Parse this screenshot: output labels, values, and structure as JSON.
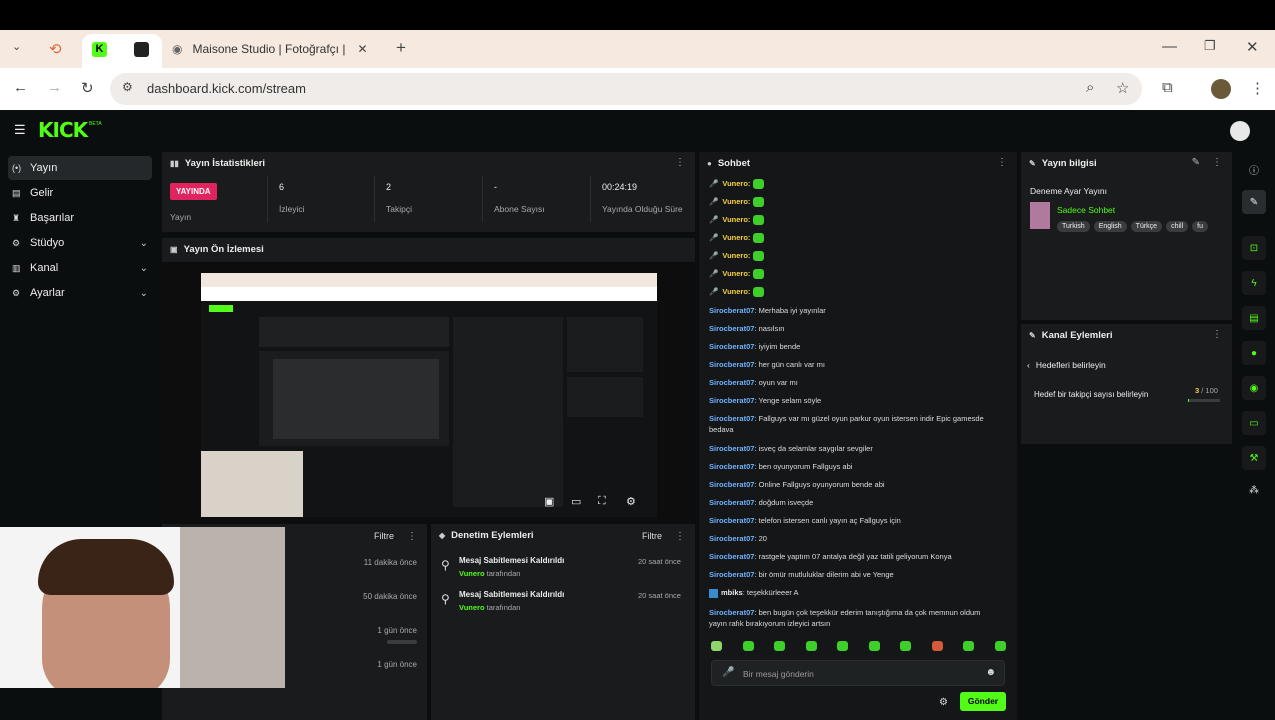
{
  "browser": {
    "tab_title": "Maisone Studio | Fotoğrafçı | İzı",
    "url": "dashboard.kick.com/stream",
    "icons": [
      "chevron-down-icon",
      "history-icon",
      "kick-favicon",
      "puzzle-favicon",
      "close-icon",
      "plus-icon",
      "back-icon",
      "forward-icon",
      "reload-icon",
      "site-info-icon",
      "zoom-icon",
      "star-icon",
      "extension-icon",
      "profile-avatar",
      "menu-icon"
    ]
  },
  "app": {
    "logo": "KICK",
    "logo_suffix": "BETA",
    "accent": "#53fc18"
  },
  "sidebar": {
    "items": [
      {
        "label": "Yayın",
        "icon": "broadcast-icon",
        "active": true
      },
      {
        "label": "Gelir",
        "icon": "wallet-icon"
      },
      {
        "label": "Başarılar",
        "icon": "trophy-icon"
      },
      {
        "label": "Stüdyo",
        "icon": "gear-icon",
        "expandable": true
      },
      {
        "label": "Kanal",
        "icon": "chart-icon",
        "expandable": true
      },
      {
        "label": "Ayarlar",
        "icon": "settings-icon",
        "expandable": true
      }
    ]
  },
  "stats": {
    "title": "Yayın İstatistikleri",
    "live_badge": "YAYINDA",
    "status_label": "Yayın",
    "viewers": "6",
    "viewers_label": "İzleyici",
    "followers": "2",
    "followers_label": "Takipçi",
    "subs": "-",
    "subs_label": "Abone Sayısı",
    "duration": "00:24:19",
    "duration_label": "Yayında Olduğu Süre"
  },
  "preview": {
    "title": "Yayın Ön İzlemesi"
  },
  "activity": {
    "filter": "Filtre",
    "times": [
      "11 dakika önce",
      "50 dakika önce",
      "1 gün önce",
      "1 gün önce"
    ]
  },
  "moderation": {
    "title": "Denetim Eylemleri",
    "filter": "Filtre",
    "rows": [
      {
        "action": "Mesaj Sabitlemesi Kaldırıldı",
        "user": "Vunero",
        "suffix": "tarafından",
        "time": "20 saat önce"
      },
      {
        "action": "Mesaj Sabitlemesi Kaldırıldı",
        "user": "Vunero",
        "suffix": "tarafından",
        "time": "20 saat önce"
      }
    ]
  },
  "chat": {
    "title": "Sohbet",
    "vunero_lines": [
      "Vunero:",
      "Vunero:",
      "Vunero:",
      "Vunero:",
      "Vunero:",
      "Vunero:",
      "Vunero:"
    ],
    "messages": [
      {
        "user": "Sirocberat07",
        "text": "Merhaba iyi yayınlar"
      },
      {
        "user": "Sirocberat07",
        "text": "nasılsın"
      },
      {
        "user": "Sirocberat07",
        "text": "iyiyim bende"
      },
      {
        "user": "Sirocberat07",
        "text": "her gün canlı var mı"
      },
      {
        "user": "Sirocberat07",
        "text": "oyun var mı"
      },
      {
        "user": "Sirocberat07",
        "text": "Yenge selam söyle"
      },
      {
        "user": "Sirocberat07",
        "text": "Fallguys var mı güzel oyun parkur oyun istersen indir Epic gamesde bedava"
      },
      {
        "user": "Sirocberat07",
        "text": "isveç da selamlar saygılar sevgiler"
      },
      {
        "user": "Sirocberat07",
        "text": "ben oyunyorum Fallguys abi"
      },
      {
        "user": "Sirocberat07",
        "text": "Online Fallguys oyunyorum bende abi"
      },
      {
        "user": "Sirocberat07",
        "text": "doğdum isveçde"
      },
      {
        "user": "Sirocberat07",
        "text": "telefon istersen canlı yayın aç Fallguys için"
      },
      {
        "user": "Sirocberat07",
        "text": "20"
      },
      {
        "user": "Sirocberat07",
        "text": "rastgele yaptım 07 antalya değil yaz tatili geliyorum Konya"
      },
      {
        "user": "Sirocberat07",
        "text": "bir ömür mutluluklar dilerim abi ve Yenge"
      },
      {
        "user": "mbiks",
        "text": "teşekkürleeer A"
      },
      {
        "user": "Sirocberat07",
        "text": "ben bugün çok teşekkür ederim tanıştığıma da çok memnun oldum yayın rafık bırakıyorum izleyici artsın"
      }
    ],
    "input_placeholder": "Bir mesaj gönderin",
    "send": "Gönder"
  },
  "stream_info": {
    "title": "Yayın bilgisi",
    "stream_title": "Deneme Ayar Yayını",
    "category": "Sadece Sohbet",
    "tags": [
      "Turkish",
      "English",
      "Türkçe",
      "chill",
      "fu"
    ]
  },
  "channel_actions": {
    "title": "Kanal Eylemleri",
    "back_label": "Hedefleri belirleyin",
    "goal_label": "Hedef bir takipçi sayısı belirleyin",
    "goal_current": "3",
    "goal_total": "/ 100",
    "goal_progress": 0.03
  }
}
